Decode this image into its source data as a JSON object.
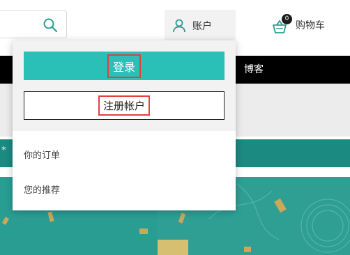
{
  "header": {
    "search_icon": "search-icon",
    "account_label": "账户",
    "account_icon": "user-icon",
    "cart_label": "购物车",
    "cart_count": "0",
    "cart_icon": "basket-icon"
  },
  "nav": {
    "items": [
      {
        "label": "博客"
      }
    ]
  },
  "account_menu": {
    "login_label": "登录",
    "register_label": "注册帐户",
    "links": [
      {
        "label": "你的订单"
      },
      {
        "label": "您的推荐"
      }
    ]
  },
  "colors": {
    "accent": "#2abfb7",
    "nav_bg": "#000000",
    "promo_bg": "#1b8a80",
    "highlight": "#e04040"
  }
}
